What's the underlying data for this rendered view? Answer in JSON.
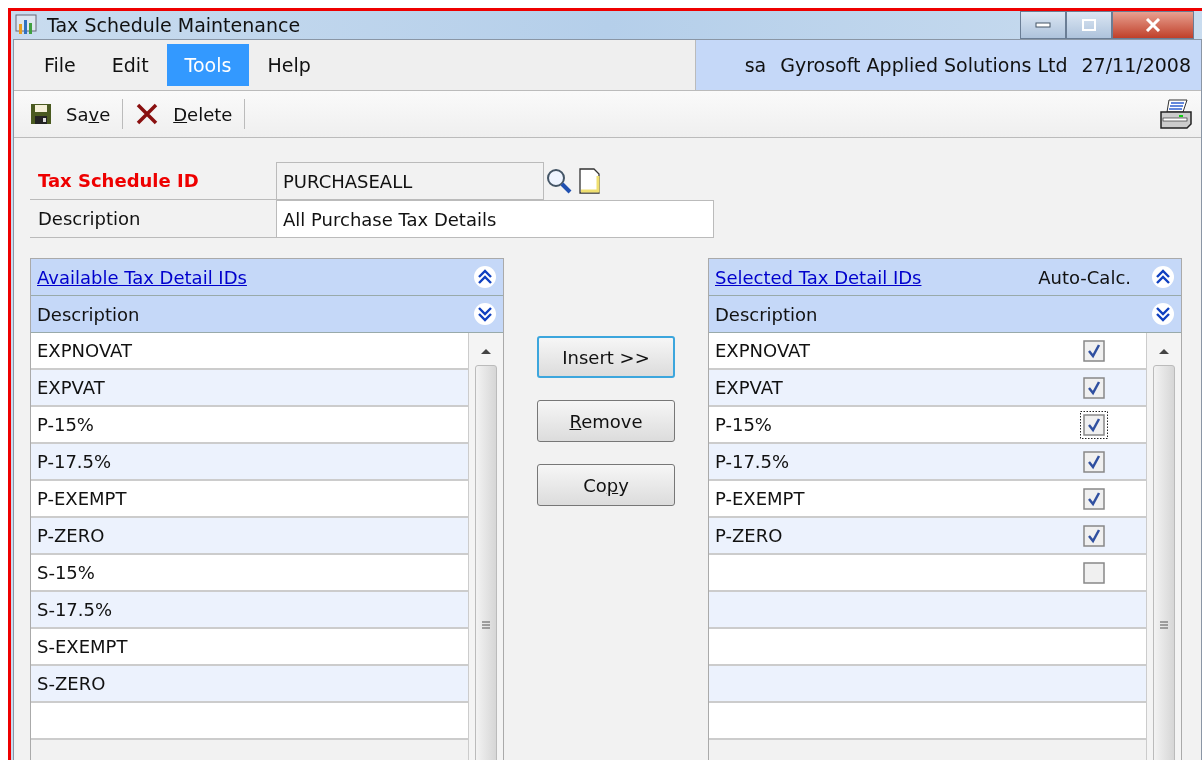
{
  "window": {
    "title": "Tax Schedule Maintenance"
  },
  "menu": [
    {
      "label": "File",
      "selected": false
    },
    {
      "label": "Edit",
      "selected": false
    },
    {
      "label": "Tools",
      "selected": true
    },
    {
      "label": "Help",
      "selected": false
    }
  ],
  "session": {
    "user": "sa",
    "company": "Gyrosoft Applied Solutions Ltd",
    "date": "27/11/2008"
  },
  "toolbar": [
    {
      "kind": "save",
      "label": {
        "before": "Sa",
        "key": "v",
        "after": "e"
      }
    },
    {
      "kind": "delete",
      "label": {
        "key": "D",
        "after": "elete"
      }
    }
  ],
  "form": {
    "id_label": "Tax Schedule ID",
    "id_value": "PURCHASEALL",
    "description_label": "Description",
    "description_value": "All Purchase Tax Details"
  },
  "available": {
    "title": "Available Tax Detail IDs",
    "column": "Description",
    "rows": [
      {
        "description": "EXPNOVAT"
      },
      {
        "description": "EXPVAT"
      },
      {
        "description": "P-15%"
      },
      {
        "description": "P-17.5%"
      },
      {
        "description": "P-EXEMPT"
      },
      {
        "description": "P-ZERO"
      },
      {
        "description": "S-15%"
      },
      {
        "description": "S-17.5%"
      },
      {
        "description": "S-EXEMPT"
      },
      {
        "description": "S-ZERO"
      }
    ]
  },
  "buttons": [
    {
      "label": {
        "before": "Insert >>"
      },
      "focused": true
    },
    {
      "label": {
        "key": "R",
        "after": "emove"
      },
      "focused": false
    },
    {
      "label": {
        "before": "Co",
        "key": "p",
        "after": "y"
      },
      "focused": false
    }
  ],
  "selected": {
    "title": "Selected Tax Detail IDs",
    "auto_calc_label": "Auto-Calc.",
    "column": "Description",
    "rows": [
      {
        "description": "EXPNOVAT",
        "auto_calc": true,
        "focused": false
      },
      {
        "description": "EXPVAT",
        "auto_calc": true,
        "focused": false
      },
      {
        "description": "P-15%",
        "auto_calc": true,
        "focused": true
      },
      {
        "description": "P-17.5%",
        "auto_calc": true,
        "focused": false
      },
      {
        "description": "P-EXEMPT",
        "auto_calc": true,
        "focused": false
      },
      {
        "description": "P-ZERO",
        "auto_calc": true,
        "focused": false
      },
      {
        "auto_calc": false,
        "focused": false
      }
    ]
  }
}
